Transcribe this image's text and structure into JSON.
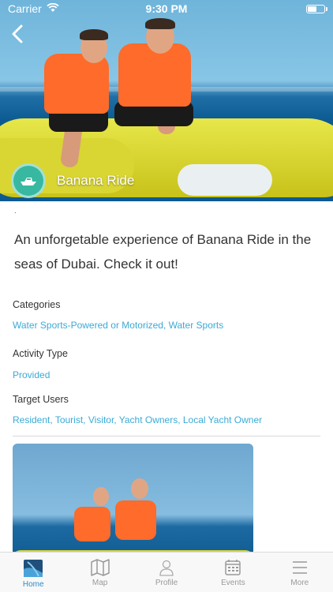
{
  "status_bar": {
    "carrier": "Carrier",
    "time": "9:30 PM"
  },
  "hero": {
    "title": "Banana Ride"
  },
  "dot": ".",
  "description": "An unforgetable experience of Banana Ride in the seas of Dubai. Check it out!",
  "sections": [
    {
      "label": "Categories",
      "value": "Water Sports-Powered or Motorized, Water Sports"
    },
    {
      "label": "Activity Type",
      "value": "Provided"
    },
    {
      "label": "Target Users",
      "value": "Resident, Tourist, Visitor, Yacht Owners, Local Yacht Owner"
    }
  ],
  "tabbar": {
    "items": [
      {
        "label": "Home",
        "icon": "home-icon",
        "active": true
      },
      {
        "label": "Map",
        "icon": "map-icon",
        "active": false
      },
      {
        "label": "Profile",
        "icon": "profile-icon",
        "active": false
      },
      {
        "label": "Events",
        "icon": "calendar-icon",
        "active": false
      },
      {
        "label": "More",
        "icon": "menu-icon",
        "active": false
      }
    ]
  },
  "colors": {
    "accent": "#3aaad6",
    "logo": "#38b8a0",
    "tab_active": "#2c8dc6"
  }
}
